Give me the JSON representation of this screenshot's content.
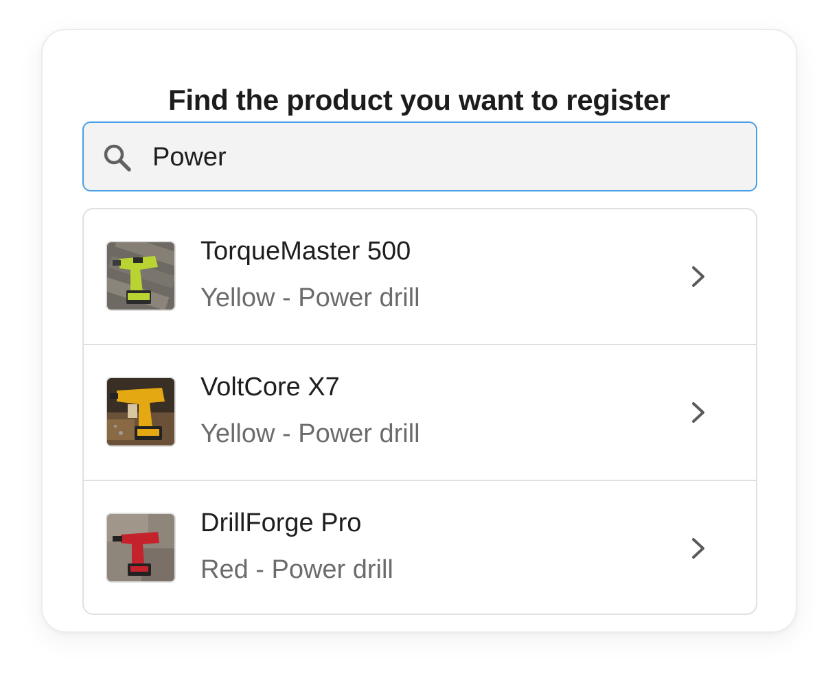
{
  "heading": "Find the product you want to register",
  "search": {
    "value": "Power",
    "icon": "search-icon"
  },
  "results": [
    {
      "name": "TorqueMaster 500",
      "description": "Yellow - Power drill",
      "thumbnail": "product-photo-yellow-drill"
    },
    {
      "name": "VoltCore X7",
      "description": "Yellow - Power drill",
      "thumbnail": "product-photo-yellow-drill"
    },
    {
      "name": "DrillForge Pro",
      "description": "Red - Power drill",
      "thumbnail": "product-photo-red-drill"
    }
  ],
  "colors": {
    "accent": "#4a9fe6",
    "title": "#1c1c1c",
    "secondary_text": "#6b6b6b",
    "search_bg": "#f3f3f3"
  }
}
